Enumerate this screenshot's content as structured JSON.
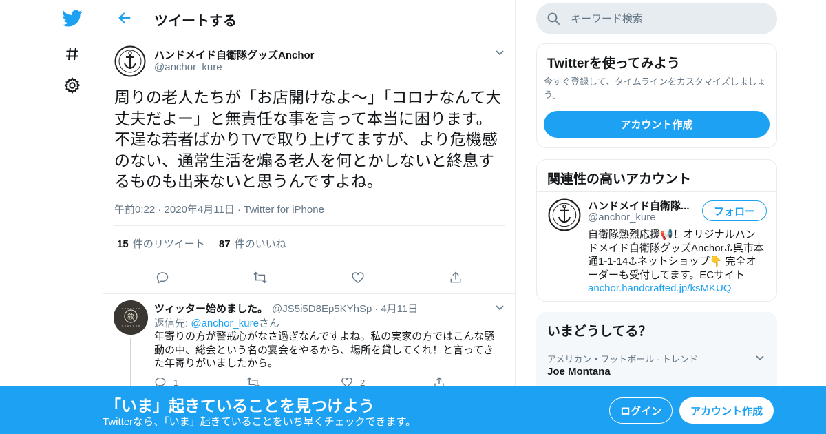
{
  "colors": {
    "accent": "#1da1f2",
    "text": "#14171a",
    "muted": "#657786",
    "border": "#e6ecf0"
  },
  "nav": {
    "icons": [
      "twitter-logo-icon",
      "hashtag-icon",
      "gear-icon"
    ]
  },
  "header": {
    "title": "ツイートする"
  },
  "tweet": {
    "author_name": "ハンドメイド自衛隊グッズAnchor",
    "author_handle": "@anchor_kure",
    "text": "周りの老人たちが「お店開けなよ〜」「コロナなんて大丈夫だよー」と無責任な事を言って本当に困ります。不逞な若者ばかりTVで取り上げてますが、より危機感のない、通常生活を煽る老人を何とかしないと終息するものも出来ないと思うんですよね。",
    "time": "午前0:22",
    "date": "2020年4月11日",
    "source": "Twitter for iPhone",
    "retweet_count": "15",
    "retweet_label": "件のリツイート",
    "like_count": "87",
    "like_label": "件のいいね"
  },
  "reply": {
    "name": "ツィッター始めました。",
    "handle": "@JS5i5D8Ep5KYhSp",
    "date": "4月11日",
    "reply_to_label": "返信先:",
    "reply_to_mention": "@anchor_kure",
    "reply_to_suffix": "さん",
    "text": "年寄りの方が警戒心がなさ過ぎなんですよね。私の実家の方ではこんな騒動の中、総会という名の宴会をやるから、場所を貸してくれ！と言ってきた年寄りがいましたから。",
    "reply_count": "1",
    "like_count": "2"
  },
  "search": {
    "placeholder": "キーワード検索"
  },
  "signup_card": {
    "title": "Twitterを使ってみよう",
    "description": "今すぐ登録して、タイムラインをカスタマイズしましょう。",
    "button": "アカウント作成"
  },
  "related_card": {
    "title": "関連性の高いアカウント",
    "name": "ハンドメイド自衛隊...",
    "handle": "@anchor_kure",
    "follow_button": "フォロー",
    "bio": "自衛隊熱烈応援📢！オリジナルハンドメイド自衛隊グッズAnchor⚓呉市本通1-1-14⚓ネットショップ👇 完全オーダーも受付してます。ECサイト",
    "bio_link": "anchor.handcrafted.jp/ksMKUQ"
  },
  "trends_card": {
    "title": "いまどうしてる？",
    "category": "アメリカン・フットボール · トレンド",
    "trend": "Joe Montana"
  },
  "banner": {
    "title": "「いま」起きていることを見つけよう",
    "subtitle": "Twitterなら、「いま」起きていることをいち早くチェックできます。",
    "login": "ログイン",
    "signup": "アカウント作成"
  }
}
